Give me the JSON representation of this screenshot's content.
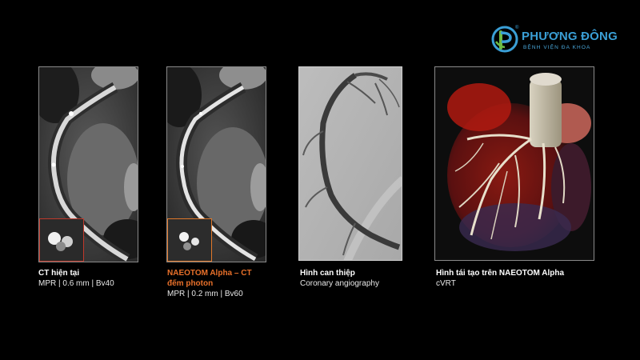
{
  "logo": {
    "name": "PHƯƠNG ĐÔNG",
    "tagline": "BỆNH VIỆN ĐA KHOA",
    "registered": "®",
    "brand_color": "#3a9fd6",
    "accent_color": "#6dbb45"
  },
  "panels": [
    {
      "title": "CT hiện tại",
      "subtitle": "MPR | 0.6 mm | Bv40",
      "inset_border_color": "#c0392b"
    },
    {
      "title_line1": "NAEOTOM Alpha – CT",
      "title_line2": "đếm photon",
      "subtitle": "MPR | 0.2 mm | Bv60",
      "title_color": "#e8702a",
      "inset_border_color": "#e0782a"
    },
    {
      "title": "Hình can thiệp",
      "subtitle": "Coronary angiography"
    },
    {
      "title": "Hình tái tạo trên NAEOTOM Alpha",
      "subtitle": "cVRT"
    }
  ]
}
